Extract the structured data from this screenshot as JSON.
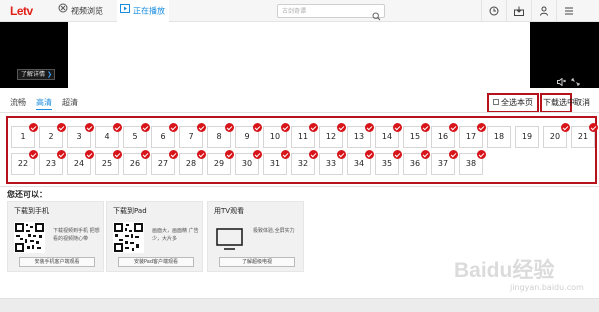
{
  "app": {
    "logo": "Letv"
  },
  "tabs": [
    {
      "label": "视频浏览"
    },
    {
      "label": "正在播放"
    }
  ],
  "search": {
    "placeholder": "古剑奇谭"
  },
  "player": {
    "detail_label": "了解详情"
  },
  "quality": {
    "options": [
      "流畅",
      "高清",
      "超清"
    ],
    "selected": "高清"
  },
  "actions": {
    "select_all": "全选本页",
    "download_selected": "下载选中",
    "cancel": "取消"
  },
  "episodes": [
    "1",
    "2",
    "3",
    "4",
    "5",
    "6",
    "7",
    "8",
    "9",
    "10",
    "11",
    "12",
    "13",
    "14",
    "15",
    "16",
    "17",
    "18",
    "19",
    "20",
    "21",
    "22",
    "23",
    "24",
    "25",
    "26",
    "27",
    "28",
    "29",
    "30",
    "31",
    "32",
    "33",
    "34",
    "35",
    "36",
    "37",
    "38"
  ],
  "also_title": "您还可以：",
  "cards": [
    {
      "title": "下载到手机",
      "desc": "下载视频到手机 把想看的视频随心带",
      "button": "安装手机客户端观看"
    },
    {
      "title": "下载到Pad",
      "desc": "画面大，画面精 广告少，大片多",
      "button": "安装Pad客户端观看"
    },
    {
      "title": "用TV观看",
      "desc": "极致体验,全屏实力",
      "button": "了解超级电视"
    }
  ],
  "watermark": {
    "main": "Baidu经验",
    "sub": "jingyan.baidu.com"
  },
  "colors": {
    "accent": "#1c8ee0",
    "highlight": "#b5121b",
    "check": "#d7141a",
    "brand": "#e21f18"
  }
}
